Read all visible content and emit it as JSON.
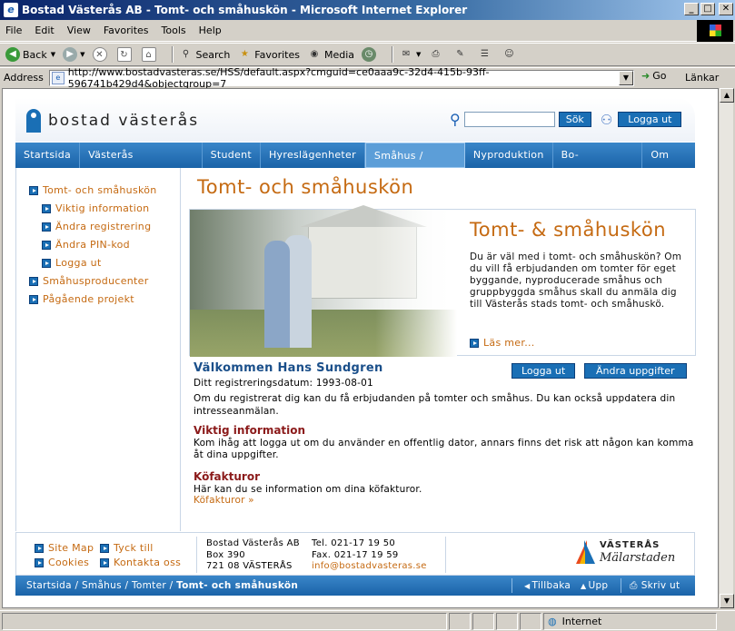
{
  "window": {
    "title": "Bostad Västerås AB - Tomt- och småhuskön - Microsoft Internet Explorer",
    "minimize": "_",
    "maximize": "□",
    "close": "✕"
  },
  "menu": [
    "File",
    "Edit",
    "View",
    "Favorites",
    "Tools",
    "Help"
  ],
  "toolbar": {
    "back": "Back",
    "search": "Search",
    "favorites": "Favorites",
    "media": "Media"
  },
  "address": {
    "label": "Address",
    "url": "http://www.bostadvasteras.se/HSS/default.aspx?cmguid=ce0aaa9c-32d4-415b-93ff-596741b429d4&objectgroup=7",
    "go": "Go",
    "links": "Länkar"
  },
  "site": {
    "logo_text": "bostad västerås",
    "search_button": "Sök",
    "logout_button": "Logga ut",
    "nav": [
      "Startsida",
      "Västerås Mälarstaden",
      "Student",
      "Hyreslägenheter",
      "Småhus / Tomter",
      "Nyproduktion",
      "Bo-information",
      "Om oss"
    ],
    "nav_active": "Småhus / Tomter"
  },
  "sidebar": {
    "items": [
      {
        "label": "Tomt- och småhuskön",
        "level": 0
      },
      {
        "label": "Viktig information",
        "level": 1
      },
      {
        "label": "Ändra registrering",
        "level": 1
      },
      {
        "label": "Ändra PIN-kod",
        "level": 1
      },
      {
        "label": "Logga ut",
        "level": 1
      },
      {
        "label": "Småhusproducenter",
        "level": 0
      },
      {
        "label": "Pågående projekt",
        "level": 0
      }
    ]
  },
  "main": {
    "title": "Tomt- och småhuskön",
    "hero_title": "Tomt- & småhuskön",
    "hero_text": "Du är väl med i tomt- och småhuskön? Om du vill få erbjudanden om tomter för eget byggande, nyproducerade småhus och gruppbyggda småhus skall du anmäla dig till Västerås stads tomt- och småhuskö.",
    "hero_link": "Läs mer...",
    "welcome": "Välkommen Hans Sundgren",
    "logout_button": "Logga ut",
    "change_button": "Ändra uppgifter",
    "reg_date": "Ditt registreringsdatum: 1993-08-01",
    "reg_text": "Om du registrerat dig kan du få erbjudanden på tomter och småhus. Du kan också uppdatera din intresseanmälan.",
    "info_heading": "Viktig information",
    "info_text": "Kom ihåg att logga ut om du använder en offentlig dator, annars finns det risk att någon kan komma åt dina uppgifter.",
    "invoice_heading": "Köfakturor",
    "invoice_text": "Här kan du se information om dina köfakturor.",
    "invoice_link": "Köfakturor »"
  },
  "footer": {
    "links": [
      "Site Map",
      "Tyck till",
      "Cookies",
      "Kontakta oss"
    ],
    "company": "Bostad Västerås AB",
    "box": "Box 390",
    "postal": "721 08 VÄSTERÅS",
    "phone": "Tel. 021-17 19 50",
    "fax": "Fax. 021-17 19 59",
    "email": "info@bostadvasteras.se",
    "partner_logo_line1": "VÄSTERÅS",
    "partner_logo_line2": "Mälarstaden",
    "breadcrumb_start": "Startsida / Småhus / Tomter / ",
    "breadcrumb_current": "Tomt- och småhuskön",
    "back": "Tillbaka",
    "up": "Upp",
    "print": "Skriv ut"
  },
  "status": {
    "zone": "Internet"
  }
}
